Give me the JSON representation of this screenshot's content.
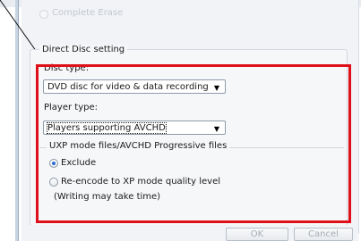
{
  "previous_section": {
    "option_label": "Complete Erase"
  },
  "direct_disc": {
    "group_title": "Direct Disc setting",
    "disc_type_label": "Disc type:",
    "disc_type_value": "DVD disc for video & data recording",
    "player_type_label": "Player type:",
    "player_type_value": "Players supporting AVCHD",
    "uxp": {
      "title": "UXP mode files/AVCHD Progressive files",
      "exclude_label": "Exclude",
      "reencode_label": "Re-encode to XP mode quality level",
      "note": "(Writing may take time)",
      "selected": "exclude"
    }
  },
  "buttons": {
    "ok": "OK",
    "cancel": "Cancel"
  },
  "colors": {
    "highlight_frame": "#e0101a",
    "radio_selected": "#2b6fd3"
  }
}
